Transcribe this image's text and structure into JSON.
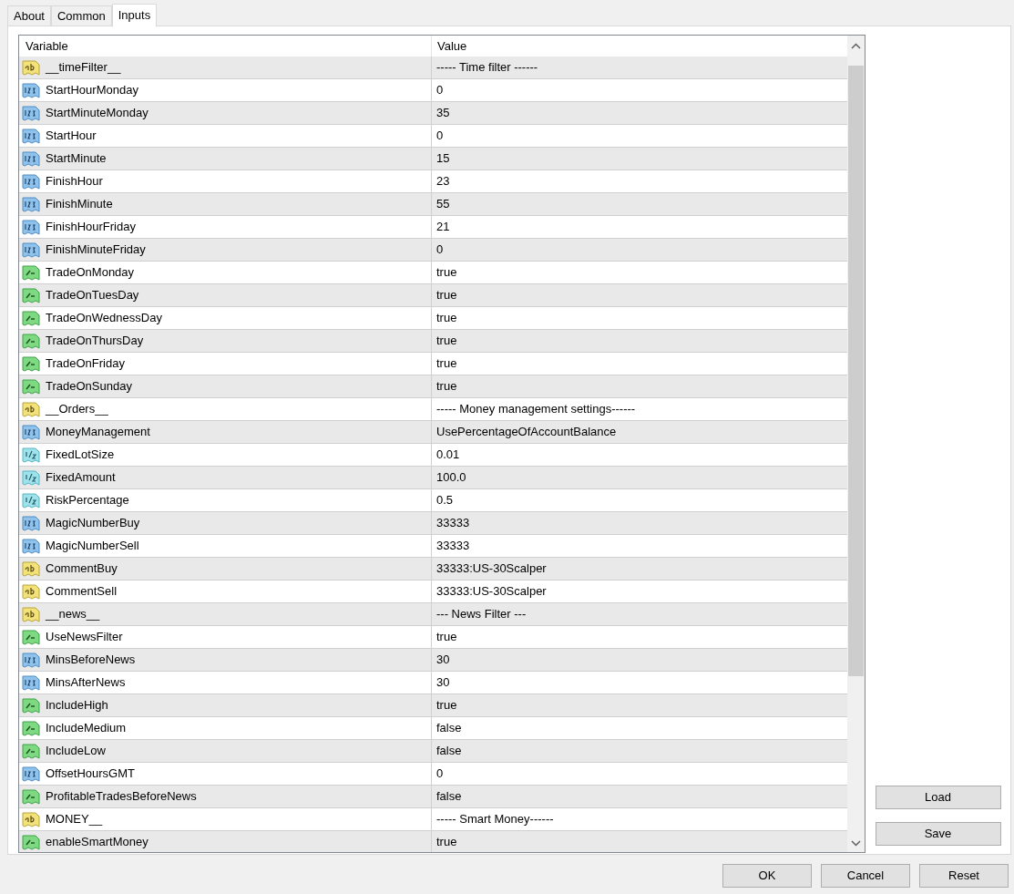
{
  "tabs": [
    {
      "label": "About",
      "selected": false
    },
    {
      "label": "Common",
      "selected": false
    },
    {
      "label": "Inputs",
      "selected": true
    }
  ],
  "table": {
    "columns": [
      "Variable",
      "Value"
    ],
    "rows": [
      {
        "kind": "string",
        "variable": "__timeFilter__",
        "value": "----- Time filter ------"
      },
      {
        "kind": "int",
        "variable": "StartHourMonday",
        "value": "0"
      },
      {
        "kind": "int",
        "variable": "StartMinuteMonday",
        "value": "35"
      },
      {
        "kind": "int",
        "variable": "StartHour",
        "value": "0"
      },
      {
        "kind": "int",
        "variable": "StartMinute",
        "value": "15"
      },
      {
        "kind": "int",
        "variable": "FinishHour",
        "value": "23"
      },
      {
        "kind": "int",
        "variable": "FinishMinute",
        "value": "55"
      },
      {
        "kind": "int",
        "variable": "FinishHourFriday",
        "value": "21"
      },
      {
        "kind": "int",
        "variable": "FinishMinuteFriday",
        "value": "0"
      },
      {
        "kind": "bool",
        "variable": "TradeOnMonday",
        "value": "true"
      },
      {
        "kind": "bool",
        "variable": "TradeOnTuesDay",
        "value": "true"
      },
      {
        "kind": "bool",
        "variable": "TradeOnWednessDay",
        "value": "true"
      },
      {
        "kind": "bool",
        "variable": "TradeOnThursDay",
        "value": "true"
      },
      {
        "kind": "bool",
        "variable": "TradeOnFriday",
        "value": "true"
      },
      {
        "kind": "bool",
        "variable": "TradeOnSunday",
        "value": "true"
      },
      {
        "kind": "string",
        "variable": "__Orders__",
        "value": "----- Money management settings------"
      },
      {
        "kind": "int",
        "variable": "MoneyManagement",
        "value": "UsePercentageOfAccountBalance"
      },
      {
        "kind": "double",
        "variable": "FixedLotSize",
        "value": "0.01"
      },
      {
        "kind": "double",
        "variable": "FixedAmount",
        "value": "100.0"
      },
      {
        "kind": "double",
        "variable": "RiskPercentage",
        "value": "0.5"
      },
      {
        "kind": "int",
        "variable": "MagicNumberBuy",
        "value": "33333"
      },
      {
        "kind": "int",
        "variable": "MagicNumberSell",
        "value": "33333"
      },
      {
        "kind": "string",
        "variable": "CommentBuy",
        "value": "33333:US-30Scalper"
      },
      {
        "kind": "string",
        "variable": "CommentSell",
        "value": "33333:US-30Scalper"
      },
      {
        "kind": "string",
        "variable": "__news__",
        "value": "--- News Filter ---"
      },
      {
        "kind": "bool",
        "variable": "UseNewsFilter",
        "value": "true"
      },
      {
        "kind": "int",
        "variable": "MinsBeforeNews",
        "value": "30"
      },
      {
        "kind": "int",
        "variable": "MinsAfterNews",
        "value": "30"
      },
      {
        "kind": "bool",
        "variable": "IncludeHigh",
        "value": "true"
      },
      {
        "kind": "bool",
        "variable": "IncludeMedium",
        "value": "false"
      },
      {
        "kind": "bool",
        "variable": "IncludeLow",
        "value": "false"
      },
      {
        "kind": "int",
        "variable": "OffsetHoursGMT",
        "value": "0"
      },
      {
        "kind": "bool",
        "variable": "ProfitableTradesBeforeNews",
        "value": "false"
      },
      {
        "kind": "string",
        "variable": "MONEY__",
        "value": "----- Smart Money------"
      },
      {
        "kind": "bool",
        "variable": "enableSmartMoney",
        "value": "true"
      }
    ]
  },
  "side_buttons": [
    "Load",
    "Save"
  ],
  "buttons": [
    "OK",
    "Cancel",
    "Reset"
  ]
}
